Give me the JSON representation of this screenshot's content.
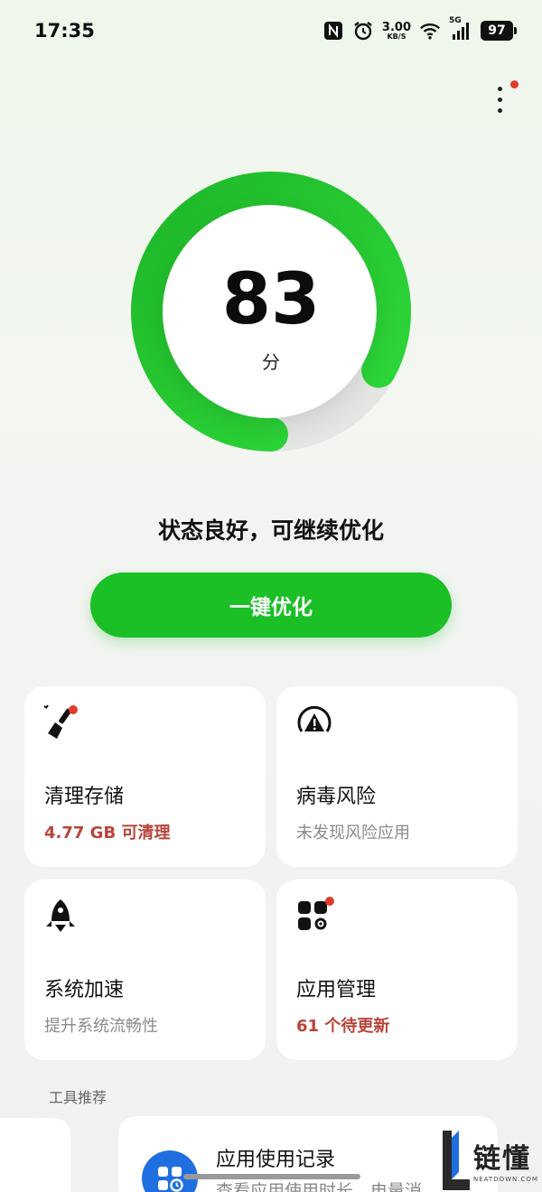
{
  "status_bar": {
    "time": "17:35",
    "net_speed_value": "3.00",
    "net_speed_unit": "KB/S",
    "network": "5G",
    "battery": "97",
    "icons": [
      "nfc-icon",
      "alarm-icon",
      "wifi-icon",
      "signal-icon",
      "battery-icon"
    ]
  },
  "score": {
    "value": "83",
    "unit": "分",
    "ring_fraction": 0.83
  },
  "status_text": "状态良好，可继续优化",
  "optimize_button": "一键优化",
  "cards": [
    {
      "icon": "broom-icon",
      "title": "清理存储",
      "subtitle": "4.77 GB 可清理",
      "badge": true
    },
    {
      "icon": "virus-warning-icon",
      "title": "病毒风险",
      "subtitle": "未发现风险应用",
      "badge": false
    },
    {
      "icon": "rocket-icon",
      "title": "系统加速",
      "subtitle": "提升系统流畅性",
      "badge": false
    },
    {
      "icon": "app-manage-icon",
      "title": "应用管理",
      "subtitle": "61 个待更新",
      "badge": true
    }
  ],
  "section_title": "工具推荐",
  "tool": {
    "icon": "app-usage-icon",
    "title": "应用使用记录",
    "subtitle": "查看应用使用时长、电量消"
  },
  "watermark": {
    "text": "链懂",
    "sub": "NEATDOWN.COM"
  },
  "colors": {
    "accent": "#1bbf26",
    "warn_text": "#b8443a",
    "badge": "#e03b2d",
    "tool_icon": "#1f6fe0"
  }
}
